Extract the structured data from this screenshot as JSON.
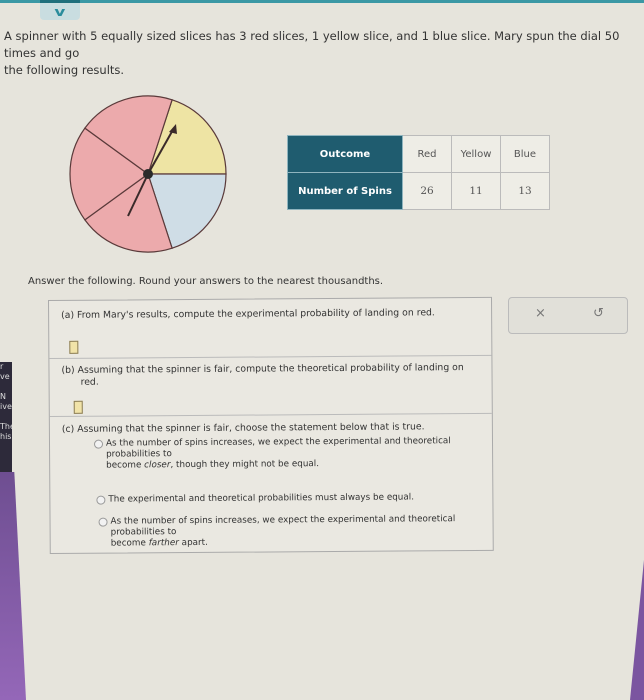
{
  "header": {
    "collapse_icon": "chevron-down-icon",
    "collapse_glyph": "v"
  },
  "problem": {
    "text": "A spinner with 5 equally sized slices has 3 red slices, 1 yellow slice, and 1 blue slice. Mary spun the dial 50 times and go",
    "text_continued": "the following results."
  },
  "spinner": {
    "slices": [
      {
        "color_name": "yellow",
        "color": "#eee4a4"
      },
      {
        "color_name": "blue",
        "color": "#cfdde6"
      },
      {
        "color_name": "red",
        "color": "#ecaaac"
      },
      {
        "color_name": "red",
        "color": "#ecaaac"
      },
      {
        "color_name": "red",
        "color": "#ecaaac"
      }
    ]
  },
  "results_table": {
    "row_header_1": "Outcome",
    "row_header_2": "Number of Spins",
    "outcomes": [
      "Red",
      "Yellow",
      "Blue"
    ],
    "counts": [
      "26",
      "11",
      "13"
    ]
  },
  "instruction": "Answer the following. Round your answers to the nearest thousandths.",
  "questions": {
    "a": {
      "text": "(a) From Mary's results, compute the experimental probability of landing on red.",
      "answer_value": ""
    },
    "b": {
      "text_line1": "(b) Assuming that the spinner is fair, compute the theoretical probability of landing on",
      "text_line2": "red.",
      "answer_value": ""
    },
    "c": {
      "text": "(c) Assuming that the spinner is fair, choose the statement below that is true.",
      "options": [
        {
          "line1": "As the number of spins increases, we expect the experimental and theoretical",
          "line2": "probabilities to",
          "line3_pre": "become ",
          "line3_em": "closer",
          "line3_post": ", though they might not be equal.",
          "selected": false
        },
        {
          "line1": "The experimental and theoretical probabilities must always be equal.",
          "selected": false
        },
        {
          "line1": "As the number of spins increases, we expect the experimental and theoretical",
          "line2": "probabilities to",
          "line3_pre": "become ",
          "line3_em": "farther",
          "line3_post": " apart.",
          "selected": false
        }
      ]
    }
  },
  "actions": {
    "clear_glyph": "×",
    "undo_glyph": "↺"
  },
  "left_panel_fragments": [
    "r",
    "ve",
    "N",
    "ive",
    "The",
    "his"
  ]
}
